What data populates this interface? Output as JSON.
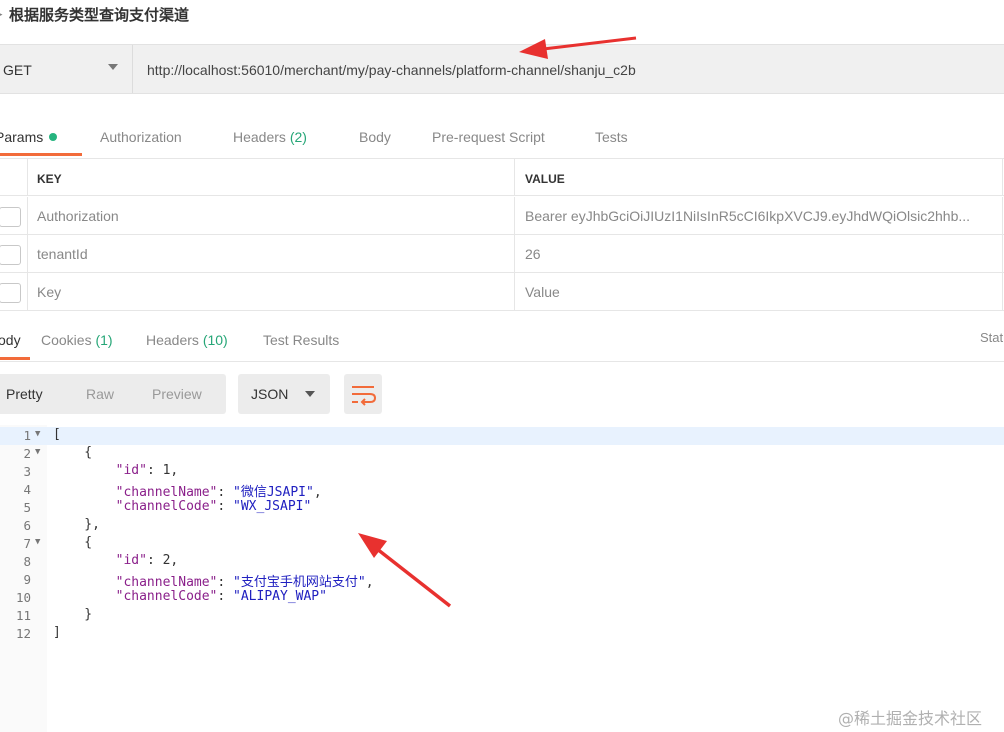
{
  "title": "根据服务类型查询支付渠道",
  "request": {
    "method": "GET",
    "url": "http://localhost:56010/merchant/my/pay-channels/platform-channel/shanju_c2b"
  },
  "request_tabs": {
    "params": "Params",
    "authorization": "Authorization",
    "headers": "Headers",
    "headers_count": "(2)",
    "body": "Body",
    "prerequest": "Pre-request Script",
    "tests": "Tests"
  },
  "params_table": {
    "key_header": "KEY",
    "value_header": "VALUE",
    "rows": [
      {
        "key": "Authorization",
        "value": "Bearer eyJhbGciOiJIUzI1NiIsInR5cCI6IkpXVCJ9.eyJhdWQiOlsic2hhb..."
      },
      {
        "key": "tenantId",
        "value": "26"
      },
      {
        "key": "Key",
        "value": "Value"
      }
    ]
  },
  "response_tabs": {
    "body": "ody",
    "cookies": "Cookies",
    "cookies_count": "(1)",
    "headers": "Headers",
    "headers_count": "(10)",
    "test_results": "Test Results",
    "status_cut": "Stat"
  },
  "format": {
    "pretty": "Pretty",
    "raw": "Raw",
    "preview": "Preview",
    "type": "JSON"
  },
  "code_lines": [
    {
      "n": "1",
      "fold": true,
      "text": "["
    },
    {
      "n": "2",
      "fold": true,
      "text": "    {"
    },
    {
      "n": "3",
      "fold": false,
      "text": "        \"id\": 1,"
    },
    {
      "n": "4",
      "fold": false,
      "text": "        \"channelName\": \"微信JSAPI\","
    },
    {
      "n": "5",
      "fold": false,
      "text": "        \"channelCode\": \"WX_JSAPI\""
    },
    {
      "n": "6",
      "fold": false,
      "text": "    },"
    },
    {
      "n": "7",
      "fold": true,
      "text": "    {"
    },
    {
      "n": "8",
      "fold": false,
      "text": "        \"id\": 2,"
    },
    {
      "n": "9",
      "fold": false,
      "text": "        \"channelName\": \"支付宝手机网站支付\","
    },
    {
      "n": "10",
      "fold": false,
      "text": "        \"channelCode\": \"ALIPAY_WAP\""
    },
    {
      "n": "11",
      "fold": false,
      "text": "    }"
    },
    {
      "n": "12",
      "fold": false,
      "text": "]"
    }
  ],
  "watermark": "@稀土掘金技术社区",
  "colors": {
    "accent": "#f26b3a",
    "count_green": "#26a677",
    "arrow_red": "#e8312f"
  }
}
